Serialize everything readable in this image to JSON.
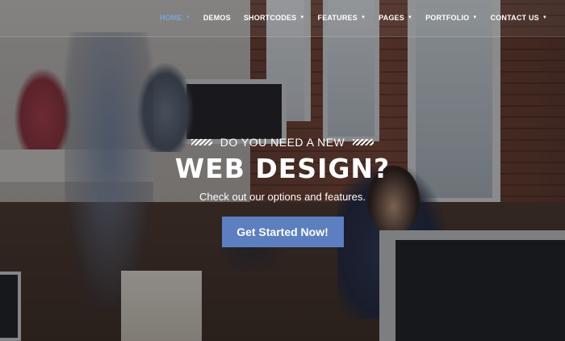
{
  "nav": {
    "items": [
      {
        "label": "HOME",
        "active": true,
        "has_dropdown": true
      },
      {
        "label": "DEMOS",
        "active": false,
        "has_dropdown": false
      },
      {
        "label": "SHORTCODES",
        "active": false,
        "has_dropdown": true
      },
      {
        "label": "FEATURES",
        "active": false,
        "has_dropdown": true
      },
      {
        "label": "PAGES",
        "active": false,
        "has_dropdown": true
      },
      {
        "label": "PORTFOLIO",
        "active": false,
        "has_dropdown": true
      },
      {
        "label": "CONTACT US",
        "active": false,
        "has_dropdown": true
      }
    ],
    "caret_icon": "chevron-down-icon"
  },
  "hero": {
    "kicker": "DO YOU NEED A NEW",
    "headline": "WEB DESIGN?",
    "subline": "Check out our options and features.",
    "cta_label": "Get Started Now!"
  },
  "colors": {
    "accent": "#5b7fc0",
    "nav_active": "#7aa3d8",
    "text": "#ffffff"
  }
}
